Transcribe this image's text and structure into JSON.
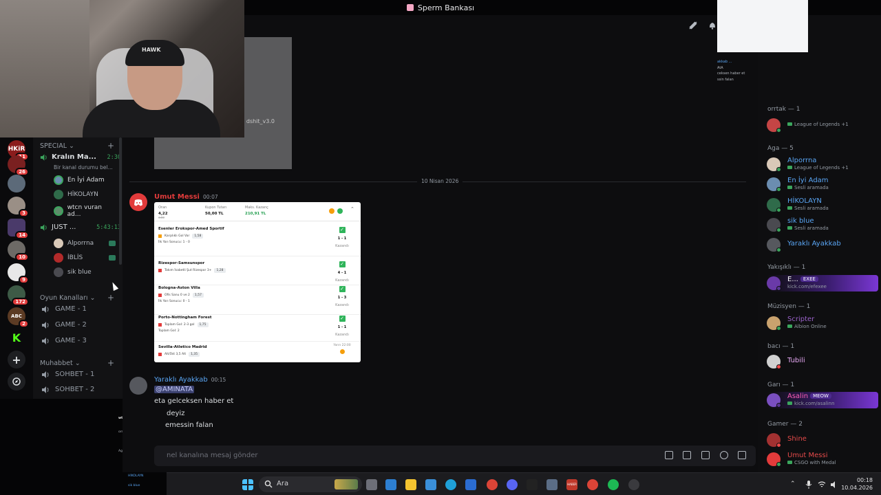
{
  "window": {
    "title": "Sperm Bankası"
  },
  "webcam": {
    "cap_text": "HAWK"
  },
  "servers": [
    {
      "label": "HKiR",
      "color": "#8b1c1c",
      "badge": "11"
    },
    {
      "label": "",
      "color": "#7a2020",
      "badge": "26"
    },
    {
      "label": "",
      "color": "#5c6a79",
      "badge": ""
    },
    {
      "label": "",
      "color": "#9a8f86",
      "badge": "3"
    },
    {
      "label": "",
      "color": "#4a3a6a",
      "badge": "14"
    },
    {
      "label": "",
      "color": "#6d6a66",
      "badge": "10"
    },
    {
      "label": "",
      "color": "#e8e8e8",
      "badge": "9"
    },
    {
      "label": "",
      "color": "#3d5a46",
      "badge": "172"
    },
    {
      "label": "ABC",
      "color": "#5c3b24",
      "badge": "2"
    },
    {
      "label": "K",
      "color": "#0a0a0c",
      "badge": ""
    }
  ],
  "channels": {
    "categories": {
      "special": "SPECIAL",
      "oyun": "Oyun Kanalları",
      "muhabbet": "Muhabbet"
    },
    "voice1": {
      "name": "Kralın Ma...",
      "time": "2:30",
      "status": "Bir kanal durumu bel..."
    },
    "voice1_users": [
      "En İyi Adam",
      "HİKOLAYN",
      "wtcn vuran ad..."
    ],
    "voice2": {
      "name": "JUST ...",
      "time": "5:43:13"
    },
    "voice2_users": [
      "Alporrna",
      "İBLİS",
      "sik blue"
    ],
    "games": [
      "GAME - 1",
      "GAME - 2",
      "GAME - 3"
    ],
    "sohbet": [
      "SOHBET - 1",
      "SOHBET - 2"
    ]
  },
  "chat": {
    "embed_label": "dshit_v3.0",
    "date_divider": "10 Nisan 2026",
    "msg1": {
      "author": "Umut Messi",
      "time": "00:07"
    },
    "slip": {
      "oran_label": "Oran",
      "oran_val": "4,22",
      "oran_old": "3,60",
      "kupon_label": "Kupon Tutarı",
      "kupon_val": "50,00 TL",
      "maks_label": "Maks. Kazanç",
      "maks_val": "210,91 TL",
      "matches": [
        {
          "title": "Esenler Erokspor-Amed Sportif",
          "pick": "Karşılıklı Gol Var",
          "odd": "1,58",
          "pick2": "İlk Yarı Sonucu: 1 - 0",
          "score": "1 - 1",
          "result": "Kazandı"
        },
        {
          "title": "Rizespor-Samsunspor",
          "pick": "Takım İsabetli Şut Rizespor 3+",
          "odd": "1,28",
          "pick2": "",
          "score": "4 - 1",
          "result": "Kazandı"
        },
        {
          "title": "Bologna-Aston Villa",
          "pick": "Ofis Sanu 0 ve 2",
          "odd": "1,57",
          "pick2": "İlk Yarı Sonucu: 0 - 1",
          "score": "1 - 3",
          "result": "Kazandı"
        },
        {
          "title": "Porto-Nottingham Forest",
          "pick": "Toplam Gol: 2-3 gol",
          "odd": "1,75",
          "pick2": "Toplam Gol: 2",
          "score": "1 - 1",
          "result": "Kazandı"
        },
        {
          "title": "Sevilla-Atletico Madrid",
          "pick": "Alt/Üst 3,5 Alt",
          "odd": "1,35",
          "pick2": "",
          "score": "Yarın 22:00",
          "result": ""
        }
      ]
    },
    "msg2": {
      "author": "Yaraklı Ayakkab",
      "time": "00:15",
      "mention": "@AMINATA",
      "lines": [
        "eta gelceksen haber et",
        "deyiz",
        "emessin falan"
      ]
    },
    "composer_placeholder": "nel kanalına mesaj gönder"
  },
  "members": {
    "groups": [
      {
        "name": "orrtak — 1"
      },
      {
        "name": "Aga — 5"
      },
      {
        "name": "Yakışıklı — 1"
      },
      {
        "name": "Müzisyen — 1"
      },
      {
        "name": "bacı — 1"
      },
      {
        "name": "Garı — 1"
      },
      {
        "name": "Gamer — 2"
      }
    ],
    "list": [
      {
        "name": "",
        "status": "League of Legends +1",
        "color": "#c44545",
        "name_color": "#dbdee1",
        "dot": "#3ba55d"
      },
      {
        "name": "Alporrna",
        "status": "League of Legends +1",
        "color": "#d9c9b8",
        "name_color": "#5aa6f5",
        "dot": "#3ba55d"
      },
      {
        "name": "En İyi Adam",
        "status": "Sesli aramada",
        "color": "#6b8db0",
        "name_color": "#5aa6f5",
        "dot": "#3ba55d"
      },
      {
        "name": "HİKOLAYN",
        "status": "Sesli aramada",
        "color": "#2f6b4a",
        "name_color": "#5aa6f5",
        "dot": "#3ba55d"
      },
      {
        "name": "sik blue",
        "status": "Sesli aramada",
        "color": "#4a4a50",
        "name_color": "#5aa6f5",
        "dot": "#3ba55d"
      },
      {
        "name": "Yaraklı Ayakkab",
        "status": "",
        "color": "#56585e",
        "name_color": "#5aa6f5",
        "dot": "#3ba55d"
      },
      {
        "name": "E...",
        "status": "kick.com/efexee",
        "tag": "EXEE",
        "color": "#6a3aa8",
        "name_color": "#ffffff",
        "dot": "#593695"
      },
      {
        "name": "Scripter",
        "status": "Albion Online",
        "color": "#c9a26e",
        "name_color": "#9a62c9",
        "dot": "#3ba55d"
      },
      {
        "name": "Tubili",
        "status": "",
        "color": "#d0d0d0",
        "name_color": "#e8a9f5",
        "dot": "#f04747"
      },
      {
        "name": "Asalin",
        "status": "kick.com/asalinn",
        "tag": "MEOW",
        "color": "#7a4fc0",
        "name_color": "#ff5eb8",
        "dot": "#593695"
      },
      {
        "name": "Shine",
        "status": "",
        "color": "#a33131",
        "name_color": "#e64b4b",
        "dot": "#f04747"
      },
      {
        "name": "Umut Messi",
        "status": "CSGO with Medal",
        "color": "#e23b3b",
        "name_color": "#e64b4b",
        "dot": "#3ba55d"
      }
    ]
  },
  "topright": {
    "lines": [
      "akkab ...",
      "AtA",
      "ceksen haber et",
      "",
      "ssin falan"
    ]
  },
  "taskbar": {
    "search": "Ara",
    "time": "00:18",
    "date": "10.04.2026",
    "news_label": "HABER"
  },
  "mini": {
    "lines": [
      "wtcn vuran adam",
      "orrtak — 1",
      "League of Legends +1",
      "Aga — 5",
      "Alporrna",
      "En İyi Adam",
      "HİKOLAYN",
      "sik blue"
    ]
  }
}
